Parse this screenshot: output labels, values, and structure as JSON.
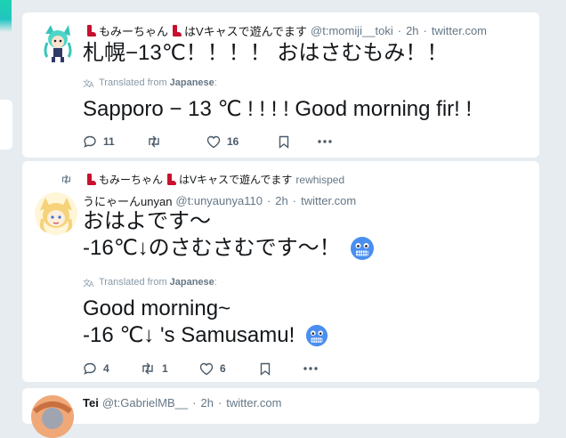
{
  "tweets": [
    {
      "display_name": "もみーちゃん",
      "display_name_suffix": "はVキャスで遊んでます",
      "handle": "@t:momiji__toki",
      "time": "2h",
      "source": "twitter.com",
      "text_lines": [
        "札幌−13℃！！！！ おはさむもみ！！"
      ],
      "translated_prefix": "Translated from",
      "translated_lang": "Japanese",
      "translated_suffix": ":",
      "translation_lines": [
        "Sapporo − 13 ℃ ! ! ! ! Good morning fir! !"
      ],
      "replies": "11",
      "retweets": "",
      "likes": "16"
    },
    {
      "rewhisper_name": "もみーちゃん",
      "rewhisper_name_suffix": "はVキャスで遊んでます",
      "rewhisper_label": "rewhisped",
      "display_name": "うにゃーんunyan",
      "handle": "@t:unyaunya110",
      "time": "2h",
      "source": "twitter.com",
      "text_lines": [
        "おはよです～",
        "-16℃↓のさむさむです～！"
      ],
      "translated_prefix": "Translated from",
      "translated_lang": "Japanese",
      "translated_suffix": ":",
      "translation_lines": [
        "Good morning~",
        "-16 ℃↓ 's Samusamu!"
      ],
      "replies": "4",
      "retweets": "1",
      "likes": "6"
    },
    {
      "display_name": "Tei",
      "handle": "@t:GabrielMB__",
      "time": "2h",
      "source": "twitter.com"
    }
  ]
}
